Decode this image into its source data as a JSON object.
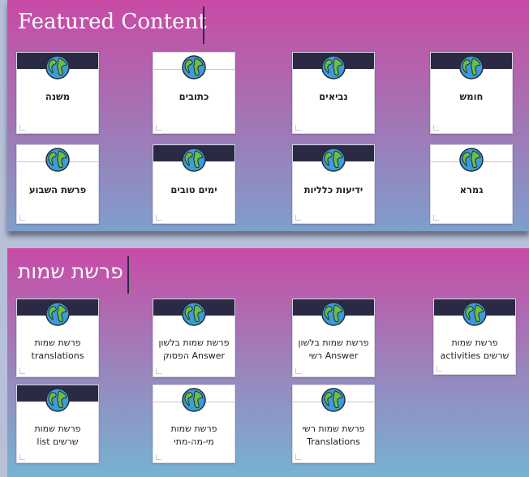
{
  "sections": [
    {
      "title": "Featured Content",
      "cards": [
        {
          "label": "משנה"
        },
        {
          "label": "כתובים"
        },
        {
          "label": "נביאים"
        },
        {
          "label": "חומש"
        },
        {
          "label": "פרשת השבוע"
        },
        {
          "label": "ימים טובים"
        },
        {
          "label": "ידיעות כלליות"
        },
        {
          "label": "גמרא"
        }
      ]
    },
    {
      "title": "פרשת שמות",
      "cards": [
        {
          "label": "פרשת שמות translations"
        },
        {
          "label": "פרשת שמות בלשון Answer הפסוק"
        },
        {
          "label": "פרשת שמות בלשון Answer רשי"
        },
        {
          "label": "פרשת שמות שרשים activities"
        },
        {
          "label": "פרשת שמות שרשים list"
        },
        {
          "label": "פרשת שמות מי-מה-מתי"
        },
        {
          "label": "פרשת שמות רשי Translations"
        }
      ]
    }
  ],
  "icons": {
    "card_icon": "globe-icon"
  },
  "colors": {
    "accent_band": "#2a2a45",
    "panel_top": "#c94aa6",
    "panel_bottom": "#7f9fcc"
  }
}
